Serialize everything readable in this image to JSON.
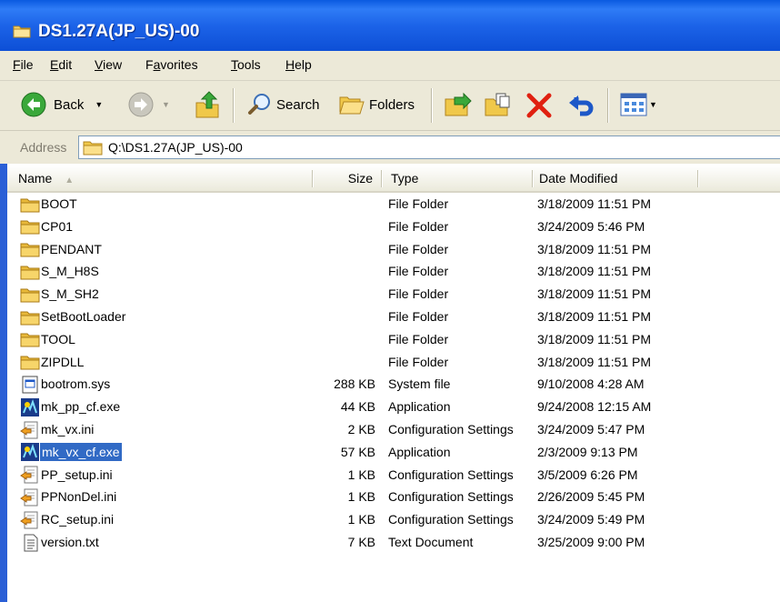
{
  "window": {
    "title": "DS1.27A(JP_US)-00"
  },
  "menu": [
    {
      "label": "File",
      "u": "F",
      "rest": "ile"
    },
    {
      "label": "Edit",
      "u": "E",
      "rest": "dit"
    },
    {
      "label": "View",
      "u": "V",
      "rest": "iew"
    },
    {
      "label": "Favorites",
      "pre": "F",
      "u": "a",
      "rest": "vorites"
    },
    {
      "label": "Tools",
      "u": "T",
      "rest": "ools"
    },
    {
      "label": "Help",
      "u": "H",
      "rest": "elp"
    }
  ],
  "toolbar": {
    "back_label": "Back",
    "search_label": "Search",
    "folders_label": "Folders"
  },
  "address": {
    "label": "Address",
    "value": "Q:\\DS1.27A(JP_US)-00"
  },
  "columns": {
    "name": "Name",
    "size": "Size",
    "type": "Type",
    "date": "Date Modified"
  },
  "files": [
    {
      "name": "BOOT",
      "size": "",
      "type": "File Folder",
      "date": "3/18/2009 11:51 PM",
      "icon": "folder"
    },
    {
      "name": "CP01",
      "size": "",
      "type": "File Folder",
      "date": "3/24/2009 5:46 PM",
      "icon": "folder"
    },
    {
      "name": "PENDANT",
      "size": "",
      "type": "File Folder",
      "date": "3/18/2009 11:51 PM",
      "icon": "folder"
    },
    {
      "name": "S_M_H8S",
      "size": "",
      "type": "File Folder",
      "date": "3/18/2009 11:51 PM",
      "icon": "folder"
    },
    {
      "name": "S_M_SH2",
      "size": "",
      "type": "File Folder",
      "date": "3/18/2009 11:51 PM",
      "icon": "folder"
    },
    {
      "name": "SetBootLoader",
      "size": "",
      "type": "File Folder",
      "date": "3/18/2009 11:51 PM",
      "icon": "folder"
    },
    {
      "name": "TOOL",
      "size": "",
      "type": "File Folder",
      "date": "3/18/2009 11:51 PM",
      "icon": "folder"
    },
    {
      "name": "ZIPDLL",
      "size": "",
      "type": "File Folder",
      "date": "3/18/2009 11:51 PM",
      "icon": "folder"
    },
    {
      "name": "bootrom.sys",
      "size": "288 KB",
      "type": "System file",
      "date": "9/10/2008 4:28 AM",
      "icon": "sys"
    },
    {
      "name": "mk_pp_cf.exe",
      "size": "44 KB",
      "type": "Application",
      "date": "9/24/2008 12:15 AM",
      "icon": "exe"
    },
    {
      "name": "mk_vx.ini",
      "size": "2 KB",
      "type": "Configuration Settings",
      "date": "3/24/2009 5:47 PM",
      "icon": "ini"
    },
    {
      "name": "mk_vx_cf.exe",
      "size": "57 KB",
      "type": "Application",
      "date": "2/3/2009 9:13 PM",
      "icon": "exe",
      "selected": true
    },
    {
      "name": "PP_setup.ini",
      "size": "1 KB",
      "type": "Configuration Settings",
      "date": "3/5/2009 6:26 PM",
      "icon": "ini"
    },
    {
      "name": "PPNonDel.ini",
      "size": "1 KB",
      "type": "Configuration Settings",
      "date": "2/26/2009 5:45 PM",
      "icon": "ini"
    },
    {
      "name": "RC_setup.ini",
      "size": "1 KB",
      "type": "Configuration Settings",
      "date": "3/24/2009 5:49 PM",
      "icon": "ini"
    },
    {
      "name": "version.txt",
      "size": "7 KB",
      "type": "Text Document",
      "date": "3/25/2009 9:00 PM",
      "icon": "txt"
    }
  ],
  "colors": {
    "title_bar": "#1c63e8",
    "selection": "#316ac5",
    "chrome": "#ece9d8",
    "folder": "#f0c84a"
  }
}
